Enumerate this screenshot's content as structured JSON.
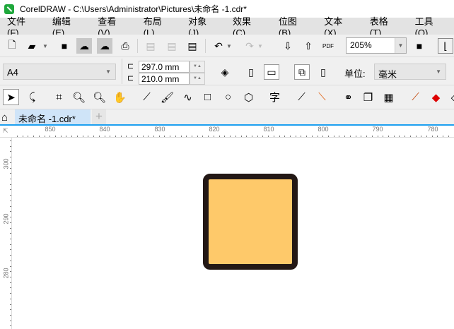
{
  "window": {
    "title": "CorelDRAW - C:\\Users\\Administrator\\Pictures\\未命名 -1.cdr*"
  },
  "menu": [
    "文件(F)",
    "编辑(E)",
    "查看(V)",
    "布局(L)",
    "对象(J)",
    "效果(C)",
    "位图(B)",
    "文本(X)",
    "表格(T)",
    "工具(O)"
  ],
  "toolbar": {
    "zoom": "205%",
    "pdf_label": "PDF"
  },
  "propbar": {
    "page_size": "A4",
    "width": "297.0 mm",
    "height": "210.0 mm",
    "units_label": "单位:",
    "units": "毫米"
  },
  "toolbox": {
    "text_tool_glyph": "字"
  },
  "tabs": {
    "document": "未命名 -1.cdr*",
    "add": "+"
  },
  "ruler": {
    "h_labels": [
      "850",
      "840",
      "830",
      "820",
      "810",
      "800",
      "790",
      "780"
    ],
    "v_labels": [
      "300",
      "290",
      "280"
    ]
  },
  "shape": {
    "fill": "#fec96a",
    "stroke": "#231815"
  }
}
